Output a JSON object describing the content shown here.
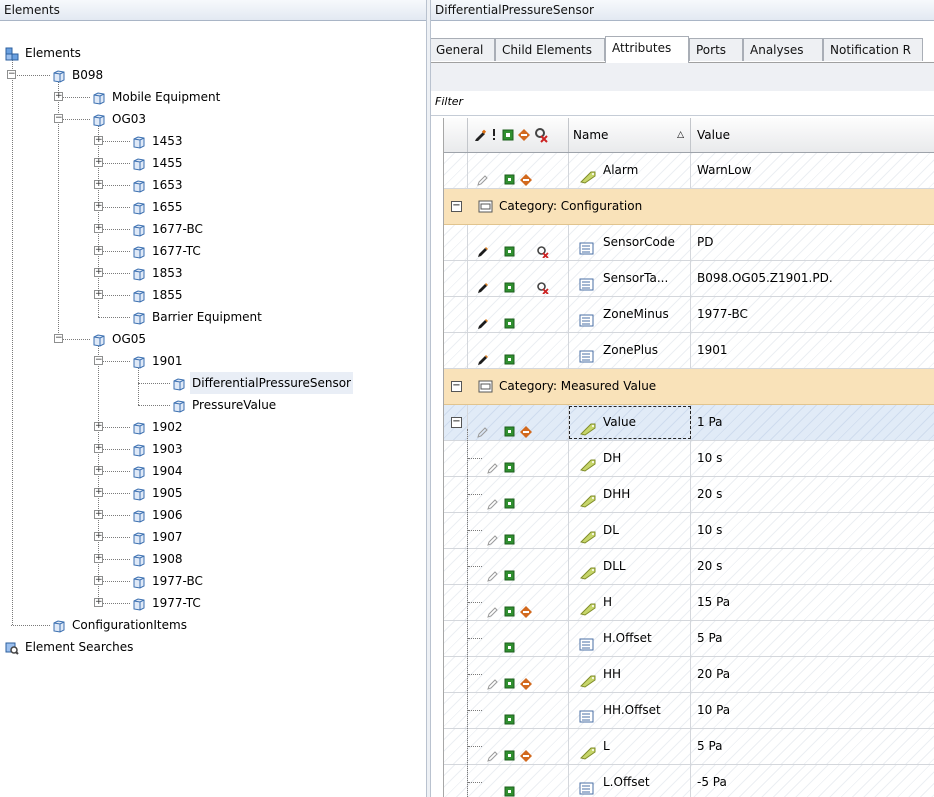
{
  "left_pane": {
    "title": "Elements",
    "tree": [
      {
        "label": "Elements",
        "level": 0,
        "icon": "elements-root-icon"
      },
      {
        "label": "B098",
        "level": 1,
        "icon": "element-icon",
        "expander": "minus"
      },
      {
        "label": "Mobile Equipment",
        "level": 2,
        "icon": "element-icon",
        "expander": "plus"
      },
      {
        "label": "OG03",
        "level": 2,
        "icon": "element-icon",
        "expander": "minus"
      },
      {
        "label": "1453",
        "level": 3,
        "icon": "element-icon",
        "expander": "plus"
      },
      {
        "label": "1455",
        "level": 3,
        "icon": "element-icon",
        "expander": "plus"
      },
      {
        "label": "1653",
        "level": 3,
        "icon": "element-icon",
        "expander": "plus"
      },
      {
        "label": "1655",
        "level": 3,
        "icon": "element-icon",
        "expander": "plus"
      },
      {
        "label": "1677-BC",
        "level": 3,
        "icon": "element-icon",
        "expander": "plus"
      },
      {
        "label": "1677-TC",
        "level": 3,
        "icon": "element-icon",
        "expander": "plus"
      },
      {
        "label": "1853",
        "level": 3,
        "icon": "element-icon",
        "expander": "plus"
      },
      {
        "label": "1855",
        "level": 3,
        "icon": "element-icon",
        "expander": "plus"
      },
      {
        "label": "Barrier Equipment",
        "level": 3,
        "icon": "element-icon",
        "expander": "none"
      },
      {
        "label": "OG05",
        "level": 2,
        "icon": "element-icon",
        "expander": "minus"
      },
      {
        "label": "1901",
        "level": 3,
        "icon": "element-icon",
        "expander": "minus"
      },
      {
        "label": "DifferentialPressureSensor",
        "level": 4,
        "icon": "element-icon",
        "expander": "none",
        "selected": true
      },
      {
        "label": "PressureValue",
        "level": 4,
        "icon": "element-icon",
        "expander": "none"
      },
      {
        "label": "1902",
        "level": 3,
        "icon": "element-icon",
        "expander": "plus"
      },
      {
        "label": "1903",
        "level": 3,
        "icon": "element-icon",
        "expander": "plus"
      },
      {
        "label": "1904",
        "level": 3,
        "icon": "element-icon",
        "expander": "plus"
      },
      {
        "label": "1905",
        "level": 3,
        "icon": "element-icon",
        "expander": "plus"
      },
      {
        "label": "1906",
        "level": 3,
        "icon": "element-icon",
        "expander": "plus"
      },
      {
        "label": "1907",
        "level": 3,
        "icon": "element-icon",
        "expander": "plus"
      },
      {
        "label": "1908",
        "level": 3,
        "icon": "element-icon",
        "expander": "plus"
      },
      {
        "label": "1977-BC",
        "level": 3,
        "icon": "element-icon",
        "expander": "plus"
      },
      {
        "label": "1977-TC",
        "level": 3,
        "icon": "element-icon",
        "expander": "plus"
      },
      {
        "label": "ConfigurationItems",
        "level": 1,
        "icon": "element-icon",
        "expander": "none"
      },
      {
        "label": "Element Searches",
        "level": 0,
        "icon": "element-searches-icon"
      }
    ]
  },
  "right_pane": {
    "title": "DifferentialPressureSensor",
    "tabs": [
      {
        "label": "General",
        "active": false
      },
      {
        "label": "Child Elements",
        "active": false
      },
      {
        "label": "Attributes",
        "active": true
      },
      {
        "label": "Ports",
        "active": false
      },
      {
        "label": "Analyses",
        "active": false
      },
      {
        "label": "Notification R",
        "active": false
      }
    ],
    "filter_label": "Filter",
    "grid": {
      "columns": {
        "name": "Name",
        "value": "Value"
      },
      "rows": [
        {
          "type": "data",
          "name": "Alarm",
          "value": "WarnLow",
          "icon": "attribute-icon",
          "pencil": "gray",
          "green": true,
          "orange": true,
          "red": false
        },
        {
          "type": "category",
          "label": "Category: Configuration"
        },
        {
          "type": "data",
          "name": "SensorCode",
          "value": "PD",
          "icon": "list-icon",
          "pencil": "dark",
          "green": true,
          "orange": false,
          "red": true
        },
        {
          "type": "data",
          "name": "SensorTa...",
          "value": "B098.OG05.Z1901.PD.",
          "icon": "list-icon",
          "pencil": "dark",
          "green": true,
          "orange": false,
          "red": true
        },
        {
          "type": "data",
          "name": "ZoneMinus",
          "value": "1977-BC",
          "icon": "list-icon",
          "pencil": "dark",
          "green": true,
          "orange": false,
          "red": false
        },
        {
          "type": "data",
          "name": "ZonePlus",
          "value": "1901",
          "icon": "list-icon",
          "pencil": "dark",
          "green": true,
          "orange": false,
          "red": false
        },
        {
          "type": "category",
          "label": "Category: Measured Value"
        },
        {
          "type": "data",
          "name": "Value",
          "value": "1 Pa",
          "icon": "attribute-icon",
          "pencil": "gray",
          "green": true,
          "orange": true,
          "red": false,
          "selected": true,
          "expander": "minus"
        },
        {
          "type": "data",
          "name": "DH",
          "value": "10 s",
          "icon": "attribute-icon",
          "pencil": "gray",
          "green": true,
          "orange": false,
          "red": false,
          "child": true
        },
        {
          "type": "data",
          "name": "DHH",
          "value": "20 s",
          "icon": "attribute-icon",
          "pencil": "gray",
          "green": true,
          "orange": false,
          "red": false,
          "child": true
        },
        {
          "type": "data",
          "name": "DL",
          "value": "10 s",
          "icon": "attribute-icon",
          "pencil": "gray",
          "green": true,
          "orange": false,
          "red": false,
          "child": true
        },
        {
          "type": "data",
          "name": "DLL",
          "value": "20 s",
          "icon": "attribute-icon",
          "pencil": "gray",
          "green": true,
          "orange": false,
          "red": false,
          "child": true
        },
        {
          "type": "data",
          "name": "H",
          "value": "15 Pa",
          "icon": "attribute-icon",
          "pencil": "gray",
          "green": true,
          "orange": true,
          "red": false,
          "child": true
        },
        {
          "type": "data",
          "name": "H.Offset",
          "value": "5 Pa",
          "icon": "list-icon",
          "pencil": "none",
          "green": true,
          "orange": false,
          "red": false,
          "child": true
        },
        {
          "type": "data",
          "name": "HH",
          "value": "20 Pa",
          "icon": "attribute-icon",
          "pencil": "gray",
          "green": true,
          "orange": true,
          "red": false,
          "child": true
        },
        {
          "type": "data",
          "name": "HH.Offset",
          "value": "10 Pa",
          "icon": "list-icon",
          "pencil": "none",
          "green": true,
          "orange": false,
          "red": false,
          "child": true
        },
        {
          "type": "data",
          "name": "L",
          "value": "5 Pa",
          "icon": "attribute-icon",
          "pencil": "gray",
          "green": true,
          "orange": true,
          "red": false,
          "child": true
        },
        {
          "type": "data",
          "name": "L.Offset",
          "value": "-5 Pa",
          "icon": "list-icon",
          "pencil": "none",
          "green": true,
          "orange": false,
          "red": false,
          "child": true
        }
      ]
    }
  },
  "colors": {
    "category_bg": "#f9e2b9",
    "selected_row": "#e1ebf7",
    "tree_icon": "#3b6fb0",
    "green_indicator": "#2f8f2f",
    "orange_indicator": "#d2691e",
    "red_indicator": "#cc2222"
  }
}
